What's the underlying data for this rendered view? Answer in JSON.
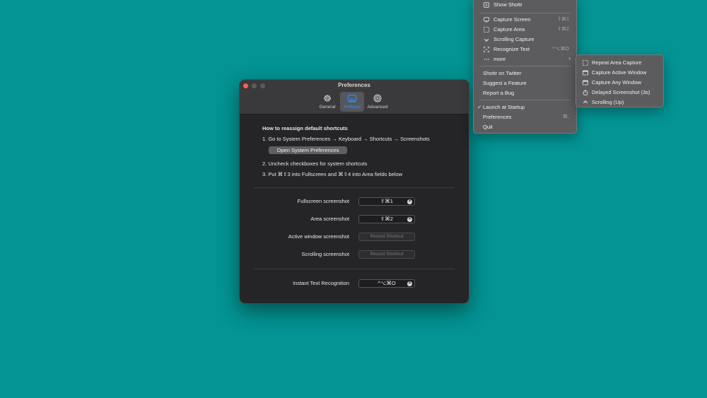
{
  "window": {
    "title": "Preferences",
    "tabs": [
      {
        "label": "General",
        "icon": "gear-icon"
      },
      {
        "label": "Hotkeys",
        "icon": "keyboard-icon"
      },
      {
        "label": "Advanced",
        "icon": "advanced-icon"
      }
    ],
    "instructions": {
      "heading": "How to reassign default shortcuts",
      "step1": "1. Go to System Preferences → Keyboard → Shortcuts → Screenshots",
      "open_button": "Open System Preferences",
      "step2": "2. Uncheck checkboxes for system shortcuts",
      "step3": "3. Put ⌘⇧3 into Fullscreen and ⌘⇧4 into Area fields below"
    },
    "shortcuts": [
      {
        "label": "Fullscreen screenshot",
        "value": "⇧⌘1"
      },
      {
        "label": "Area screenshot",
        "value": "⇧⌘2"
      },
      {
        "label": "Active window screenshot",
        "value": "Record Shortcut"
      },
      {
        "label": "Scrolling screenshot",
        "value": "Record Shortcut"
      }
    ],
    "ocr": {
      "label": "Instant Text Recognition",
      "value": "^⌥⌘O"
    }
  },
  "menu": {
    "show": "Show Shottr",
    "capture_screen": {
      "label": "Capture Screen",
      "key": "⇧⌘1"
    },
    "capture_area": {
      "label": "Capture Area",
      "key": "⇧⌘2"
    },
    "scrolling_capture": {
      "label": "Scrolling Capture"
    },
    "recognize_text": {
      "label": "Recognize Text",
      "key": "^⌥⌘O"
    },
    "more": "more",
    "twitter": "Shottr on Twitter",
    "suggest": "Suggest a Feature",
    "bug": "Report a Bug",
    "launch": "Launch at Startup",
    "launch_checked": true,
    "preferences": {
      "label": "Preferences",
      "key": "⌘,"
    },
    "quit": "Quit"
  },
  "submenu": {
    "items": [
      "Repeat Area Capture",
      "Capture Active Window",
      "Capture Any Window",
      "Delayed Screenshot (3s)",
      "Scrolling (Up)"
    ]
  },
  "colors": {
    "desktop": "#039493",
    "accent": "#2f8ff5",
    "close": "#fe5f57"
  }
}
